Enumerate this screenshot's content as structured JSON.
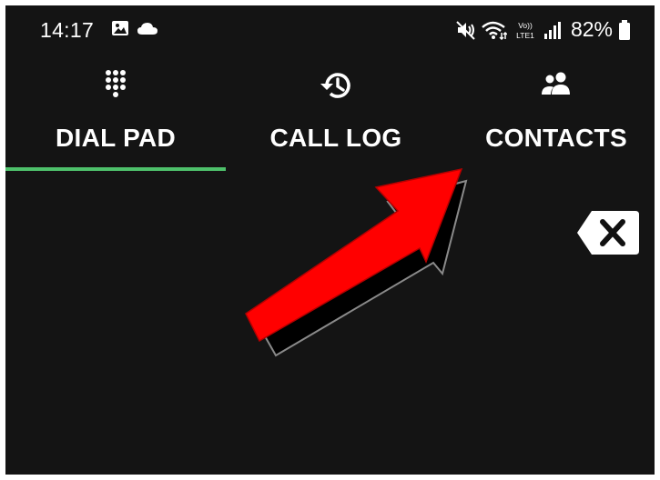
{
  "statusbar": {
    "time": "14:17",
    "battery": "82%",
    "icons": [
      "gallery-icon",
      "cloud-icon",
      "mute-icon",
      "wifi-icon",
      "volte-icon",
      "signal-icon",
      "battery-icon"
    ]
  },
  "tabs": [
    {
      "label": "DIAL PAD",
      "icon": "dialpad-icon",
      "selected": true
    },
    {
      "label": "CALL LOG",
      "icon": "history-icon",
      "selected": false
    },
    {
      "label": "CONTACTS",
      "icon": "contacts-icon",
      "selected": false
    }
  ],
  "colors": {
    "background": "#141414",
    "indicator": "#4ec16b",
    "annotation_arrow": "#ff0000"
  }
}
